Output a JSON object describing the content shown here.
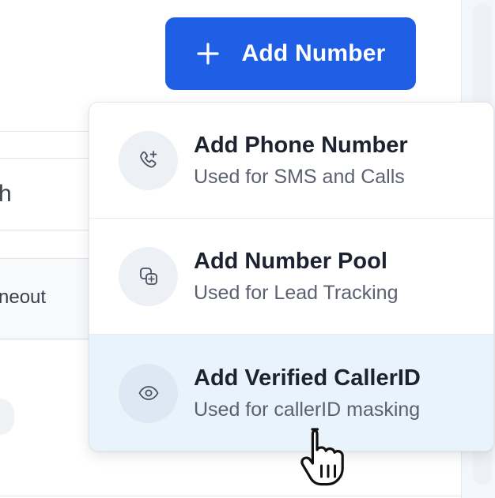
{
  "header": {
    "add_number_label": "Add Number",
    "add_number_icon": "plus-icon",
    "button_color": "#1f5fe6"
  },
  "background": {
    "field_fragment_1": "h",
    "field_fragment_2": "neout"
  },
  "dropdown": {
    "items": [
      {
        "icon": "phone-plus-icon",
        "title": "Add Phone Number",
        "subtitle": "Used for SMS and Calls"
      },
      {
        "icon": "number-pool-icon",
        "title": "Add Number Pool",
        "subtitle": "Used for Lead Tracking"
      },
      {
        "icon": "eye-icon",
        "title": "Add Verified CallerID",
        "subtitle": "Used for callerID masking",
        "highlighted": true
      }
    ],
    "highlight_color": "#e9f3fc"
  }
}
